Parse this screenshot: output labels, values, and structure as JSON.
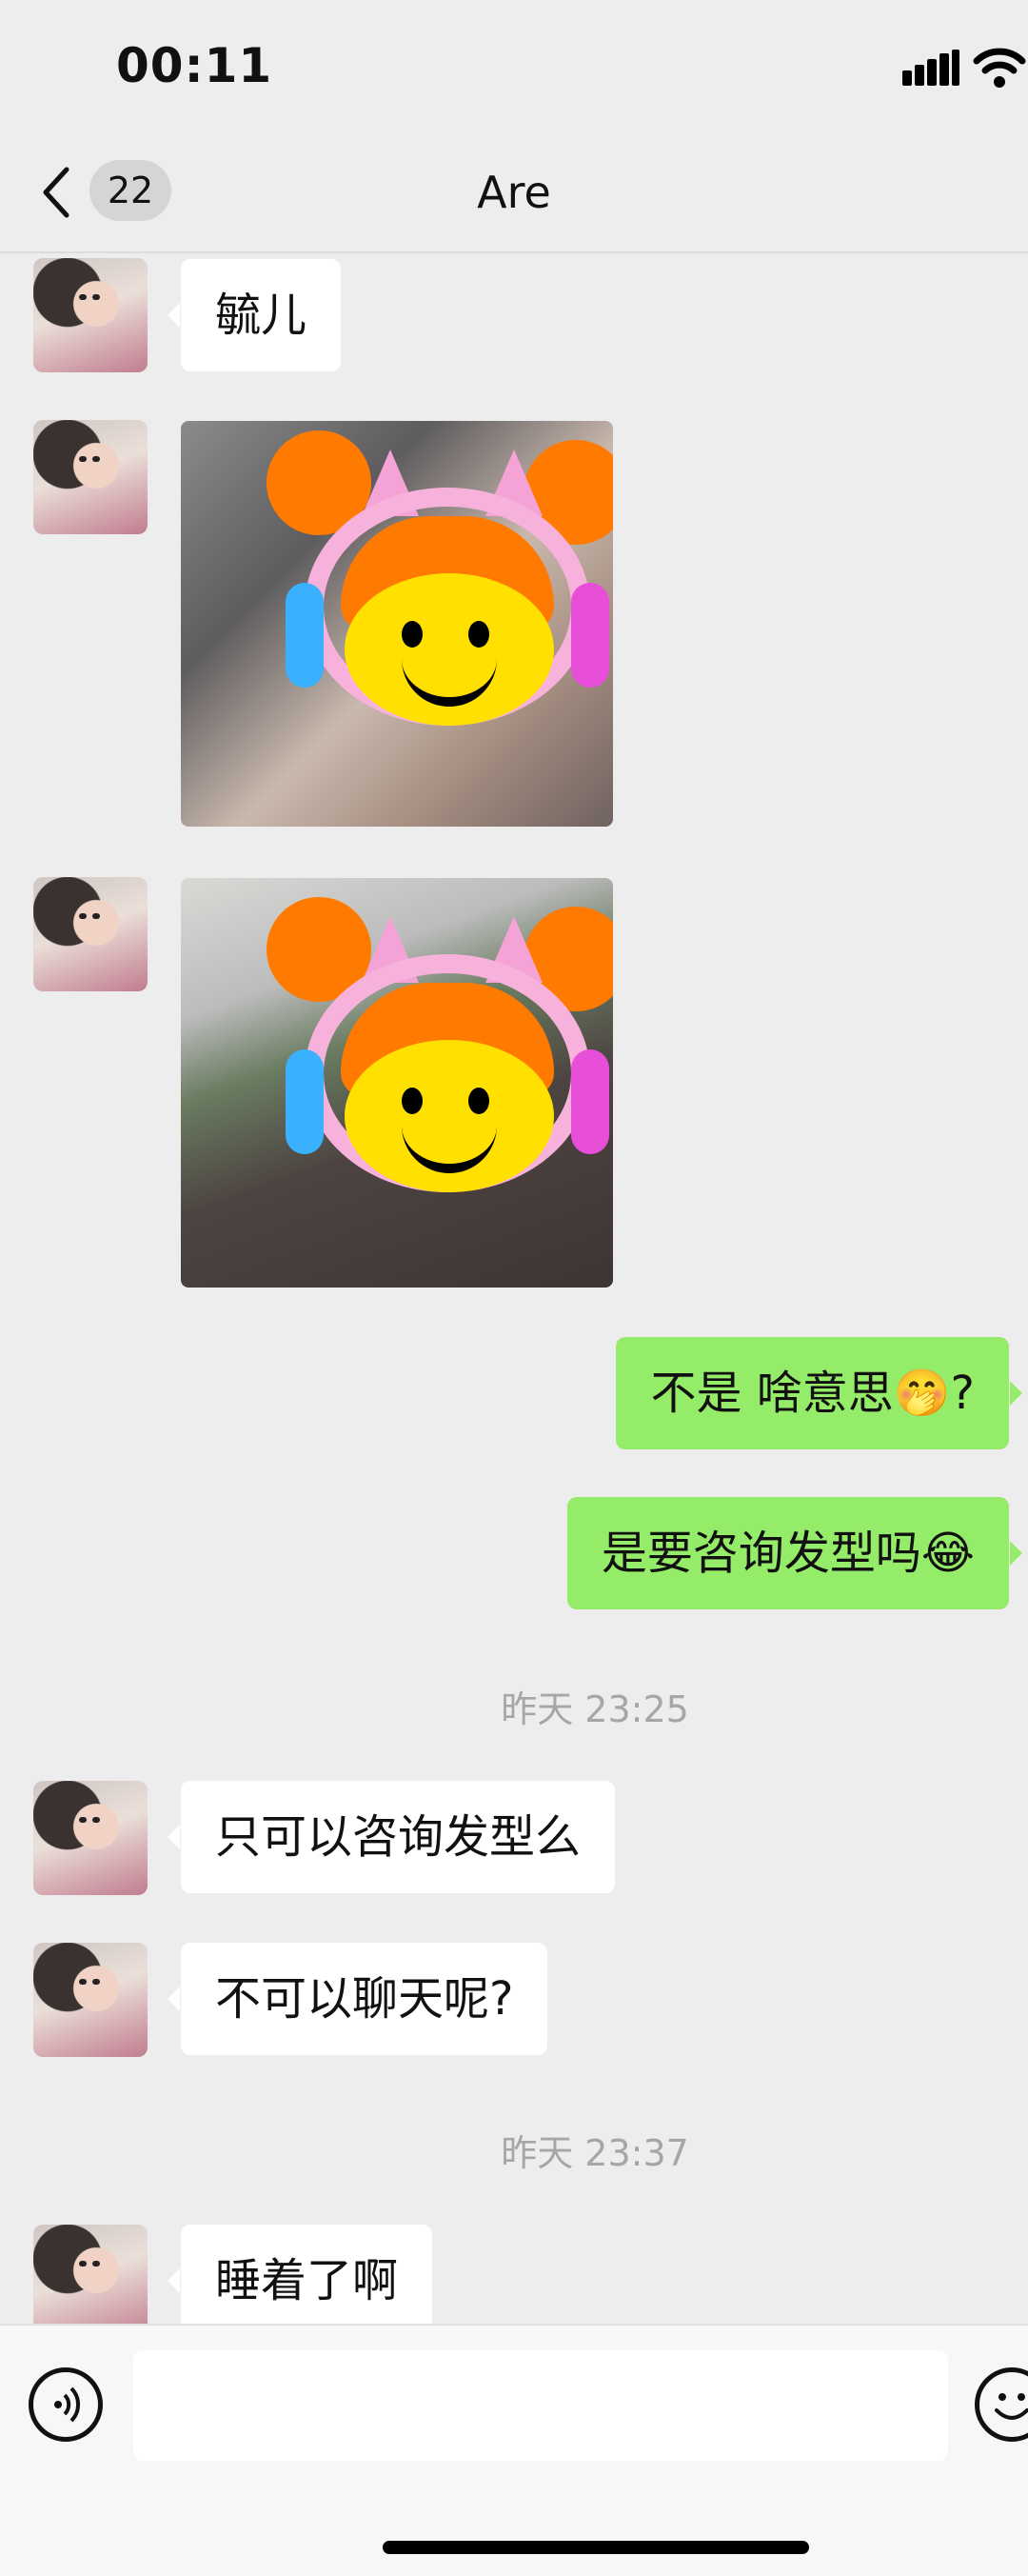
{
  "status": {
    "time": "00:11"
  },
  "nav": {
    "back_count": "22",
    "title": "Are"
  },
  "messages": [
    {
      "type": "text",
      "side": "left",
      "text": "毓儿"
    },
    {
      "type": "image",
      "side": "left"
    },
    {
      "type": "image",
      "side": "left"
    },
    {
      "type": "text",
      "side": "right",
      "text": "不是 啥意思🤭?"
    },
    {
      "type": "text",
      "side": "right",
      "text": "是要咨询发型吗😂"
    },
    {
      "type": "time",
      "text": "昨天 23:25"
    },
    {
      "type": "text",
      "side": "left",
      "text": "只可以咨询发型么"
    },
    {
      "type": "text",
      "side": "left",
      "text": "不可以聊天呢?"
    },
    {
      "type": "time",
      "text": "昨天 23:37"
    },
    {
      "type": "text",
      "side": "left",
      "text": "睡着了啊"
    }
  ],
  "input": {
    "value": ""
  },
  "icons": {
    "voice": "voice-icon",
    "emoji": "emoji-icon",
    "back": "chevron-left-icon"
  },
  "colors": {
    "bubble_right": "#95ec69",
    "background": "#ededed"
  }
}
